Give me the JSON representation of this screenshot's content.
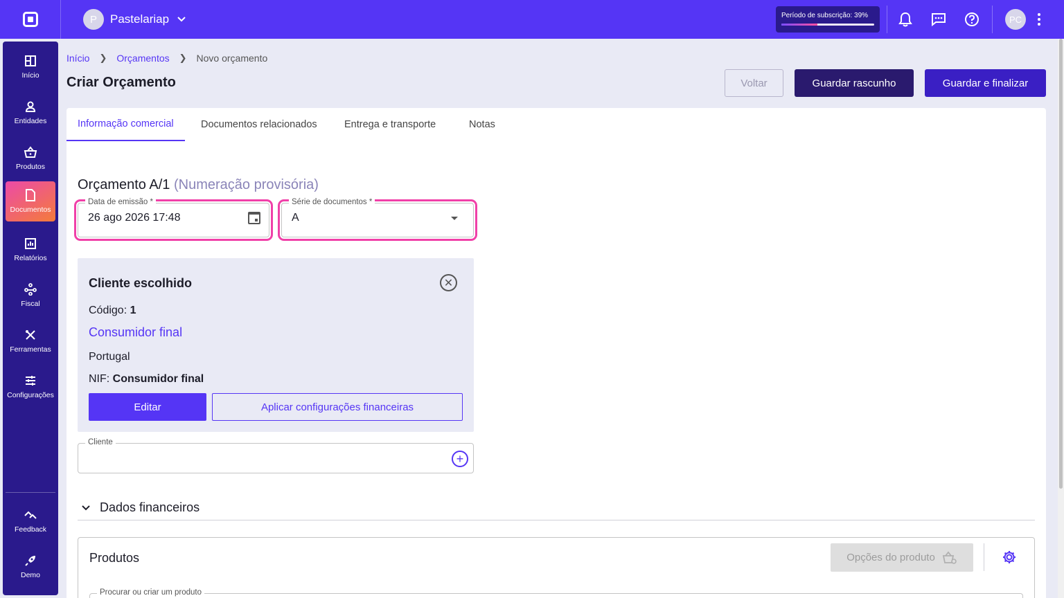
{
  "topbar": {
    "company_initial": "P",
    "company_name": "Pastelariap",
    "subscription_label": "Período de subscrição: 39%",
    "subscription_progress": 0.39,
    "user_initials": "PC"
  },
  "sidebar": {
    "items": [
      {
        "label": "Início",
        "icon": "grid-icon"
      },
      {
        "label": "Entidades",
        "icon": "person-icon"
      },
      {
        "label": "Produtos",
        "icon": "basket-icon"
      },
      {
        "label": "Documentos",
        "icon": "document-icon",
        "active": true
      },
      {
        "label": "Relatórios",
        "icon": "report-icon"
      },
      {
        "label": "Fiscal",
        "icon": "hierarchy-icon"
      },
      {
        "label": "Ferramentas",
        "icon": "tools-icon"
      },
      {
        "label": "Configurações",
        "icon": "sliders-icon"
      }
    ],
    "bottom": [
      {
        "label": "Feedback",
        "icon": "feedback-icon"
      },
      {
        "label": "Demo",
        "icon": "rocket-icon"
      }
    ]
  },
  "breadcrumb": {
    "home": "Início",
    "section": "Orçamentos",
    "current": "Novo orçamento"
  },
  "page": {
    "title": "Criar Orçamento",
    "back_label": "Voltar",
    "draft_label": "Guardar rascunho",
    "finalize_label": "Guardar e finalizar"
  },
  "tabs": [
    "Informação comercial",
    "Documentos relacionados",
    "Entrega e transporte",
    "Notas"
  ],
  "document": {
    "title": "Orçamento A/1",
    "provisional": "(Numeração provisória)",
    "date_label": "Data de emissão *",
    "date_value": "26 ago 2026 17:48",
    "series_label": "Série de documentos *",
    "series_value": "A"
  },
  "client": {
    "heading": "Cliente escolhido",
    "code_label": "Código:",
    "code_value": "1",
    "name": "Consumidor final",
    "country": "Portugal",
    "nif_label": "NIF:",
    "nif_value": "Consumidor final",
    "edit_label": "Editar",
    "apply_label": "Aplicar configurações financeiras",
    "field_label": "Cliente"
  },
  "financial": {
    "label": "Dados financeiros"
  },
  "products": {
    "title": "Produtos",
    "options_label": "Opções do produto",
    "search_label": "Procurar ou criar um produto"
  },
  "colors": {
    "primary": "#5535f5",
    "sidebar": "#2a1a8c",
    "highlight": "#f040a8"
  }
}
